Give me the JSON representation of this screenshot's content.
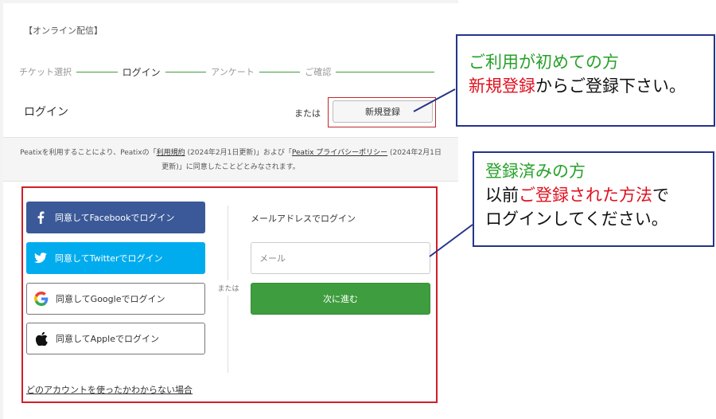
{
  "event_tag": "【オンライン配信】",
  "steps": [
    {
      "label": "チケット選択"
    },
    {
      "label": "ログイン"
    },
    {
      "label": "アンケート"
    },
    {
      "label": "ご確認"
    }
  ],
  "login": {
    "title": "ログイン",
    "or_label": "または",
    "register_label": "新規登録"
  },
  "notice": {
    "part1": "Peatixを利用することにより、Peatixの「",
    "terms_link": "利用規約",
    "part2": " (2024年2月1日更新)」および「",
    "privacy_link": "Peatix プライバシーポリシー",
    "part3": " (2024年2月1日更新)」に同意したことどとみなされます。"
  },
  "social": {
    "facebook_label": "同意してFacebookでログイン",
    "twitter_label": "同意してTwitterでログイン",
    "google_label": "同意してGoogleでログイン",
    "apple_label": "同意してAppleでログイン"
  },
  "divider_or": "または",
  "email": {
    "label": "メールアドレスでログイン",
    "placeholder": "メール",
    "value": "",
    "next_label": "次に進む"
  },
  "unknown_account_link": "どのアカウントを使ったかわからない場合",
  "callout_new": {
    "line1": "ご利用が初めての方",
    "line2_red": "新規登録",
    "line2_rest": "からご登録下さい。"
  },
  "callout_existing": {
    "line1": "登録済みの方",
    "line2_pre": "以前",
    "line2_red": "ご登録された方法",
    "line2_post": "で",
    "line3": "ログインしてください。"
  },
  "colors": {
    "accent_green": "#3e9d3e",
    "facebook": "#3b5998",
    "twitter": "#00acee",
    "highlight_red": "#d21e28",
    "callout_border": "#24348a"
  },
  "icons": {
    "facebook": "facebook-icon",
    "twitter": "twitter-icon",
    "google": "google-icon",
    "apple": "apple-icon"
  }
}
